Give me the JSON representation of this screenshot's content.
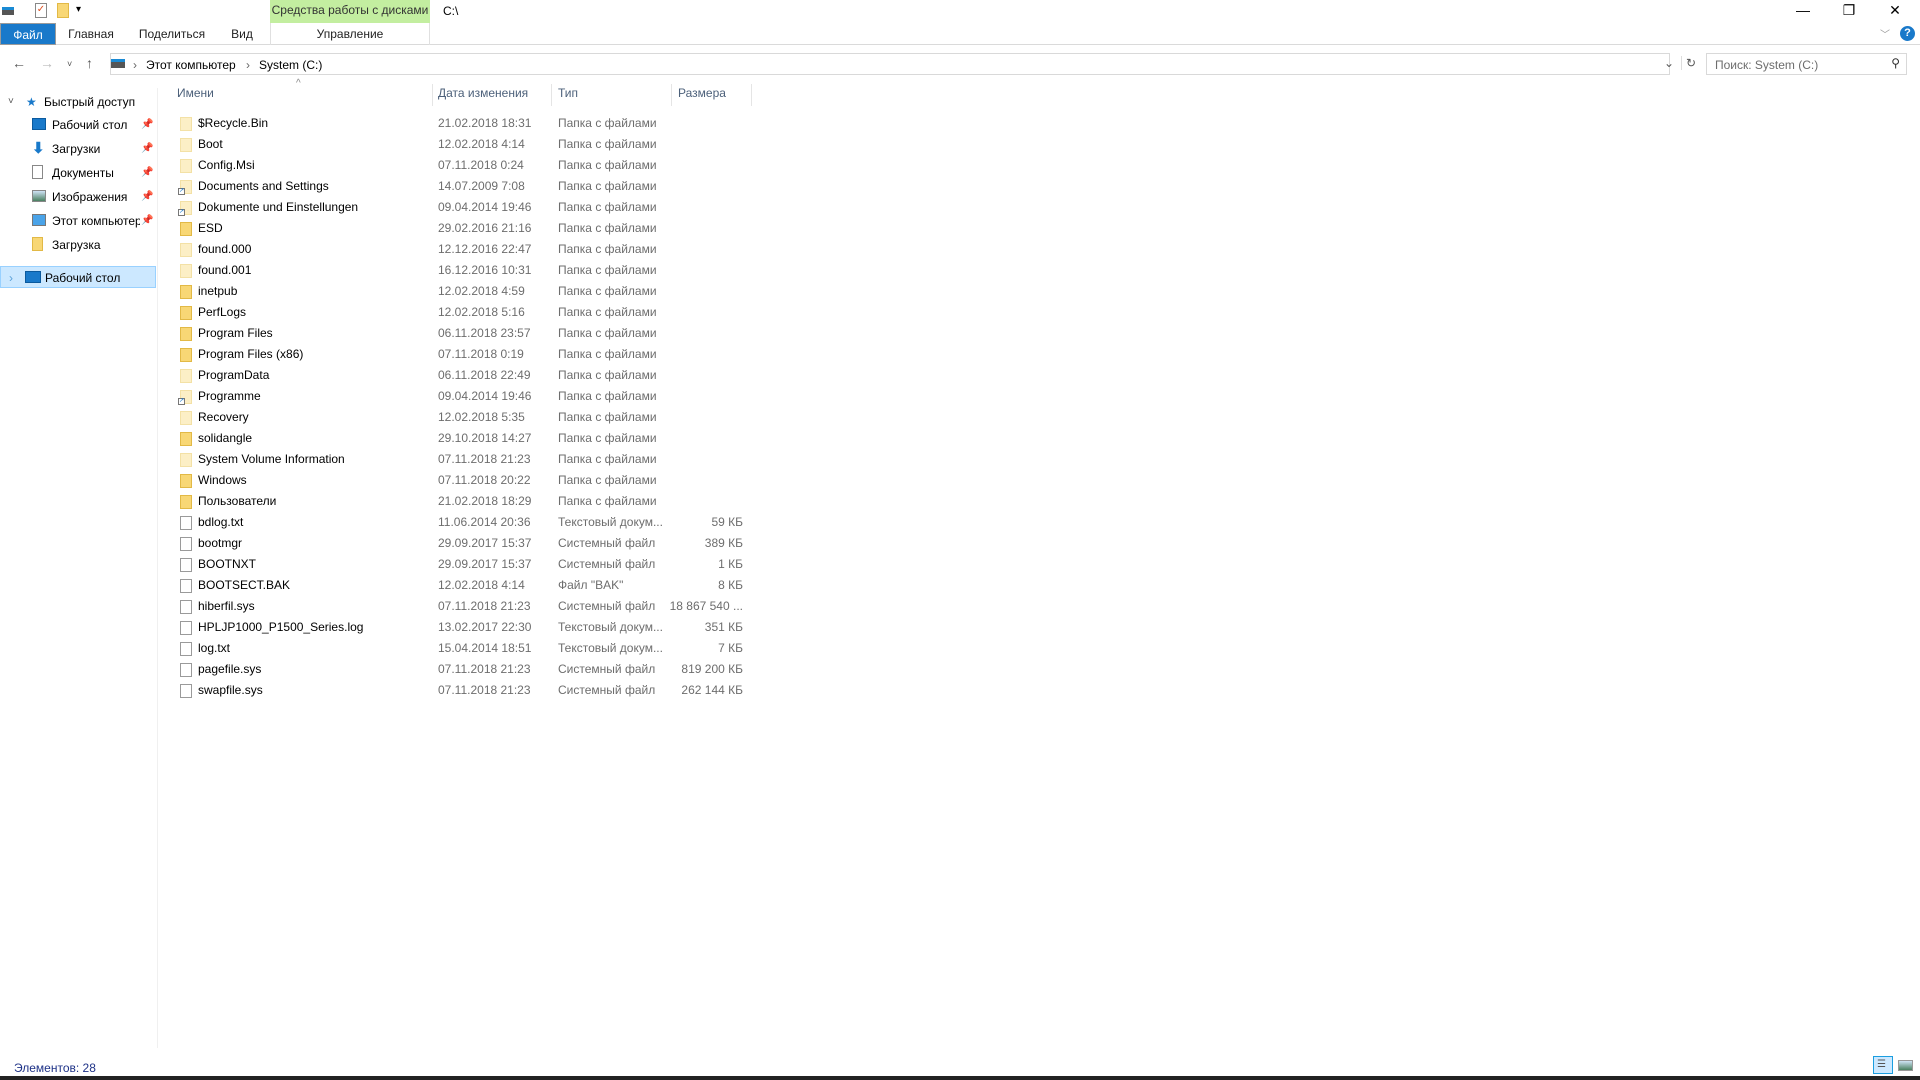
{
  "titlebar": {
    "title": "C:\\",
    "context_group": "Средства работы с дисками",
    "minimize": "—",
    "restore": "❐",
    "close": "✕"
  },
  "ribbon": {
    "tabs": [
      "Файл",
      "Главная",
      "Поделиться",
      "Вид"
    ],
    "context_tab": "Управление",
    "help": "?"
  },
  "address": {
    "path": [
      "Этот компьютер",
      "System (C:)"
    ],
    "search_placeholder": "Поиск: System (C:)"
  },
  "nav": {
    "quick_access": "Быстрый доступ",
    "items": [
      {
        "label": "Рабочий стол",
        "pinned": true,
        "icon": "desktop-icon"
      },
      {
        "label": "Загрузки",
        "pinned": true,
        "icon": "download-icon"
      },
      {
        "label": "Документы",
        "pinned": true,
        "icon": "documents-icon"
      },
      {
        "label": "Изображения",
        "pinned": true,
        "icon": "pictures-icon"
      },
      {
        "label": "Этот компьютер",
        "pinned": true,
        "icon": "computer-icon"
      },
      {
        "label": "Загрузка",
        "pinned": false,
        "icon": "folder-icon"
      }
    ],
    "desktop": "Рабочий стол"
  },
  "columns": {
    "name": "Имени",
    "date": "Дата изменения",
    "type": "Тип",
    "size": "Размера"
  },
  "files": [
    {
      "name": "$Recycle.Bin",
      "date": "21.02.2018 18:31",
      "type": "Папка с файлами",
      "size": "",
      "kind": "hidden-folder"
    },
    {
      "name": "Boot",
      "date": "12.02.2018 4:14",
      "type": "Папка с файлами",
      "size": "",
      "kind": "hidden-folder"
    },
    {
      "name": "Config.Msi",
      "date": "07.11.2018 0:24",
      "type": "Папка с файлами",
      "size": "",
      "kind": "hidden-folder"
    },
    {
      "name": "Documents and Settings",
      "date": "14.07.2009 7:08",
      "type": "Папка с файлами",
      "size": "",
      "kind": "link-folder"
    },
    {
      "name": "Dokumente und Einstellungen",
      "date": "09.04.2014 19:46",
      "type": "Папка с файлами",
      "size": "",
      "kind": "link-folder"
    },
    {
      "name": "ESD",
      "date": "29.02.2016 21:16",
      "type": "Папка с файлами",
      "size": "",
      "kind": "folder"
    },
    {
      "name": "found.000",
      "date": "12.12.2016 22:47",
      "type": "Папка с файлами",
      "size": "",
      "kind": "hidden-folder"
    },
    {
      "name": "found.001",
      "date": "16.12.2016 10:31",
      "type": "Папка с файлами",
      "size": "",
      "kind": "hidden-folder"
    },
    {
      "name": "inetpub",
      "date": "12.02.2018 4:59",
      "type": "Папка с файлами",
      "size": "",
      "kind": "folder"
    },
    {
      "name": "PerfLogs",
      "date": "12.02.2018 5:16",
      "type": "Папка с файлами",
      "size": "",
      "kind": "folder"
    },
    {
      "name": "Program Files",
      "date": "06.11.2018 23:57",
      "type": "Папка с файлами",
      "size": "",
      "kind": "folder"
    },
    {
      "name": "Program Files (x86)",
      "date": "07.11.2018 0:19",
      "type": "Папка с файлами",
      "size": "",
      "kind": "folder"
    },
    {
      "name": "ProgramData",
      "date": "06.11.2018 22:49",
      "type": "Папка с файлами",
      "size": "",
      "kind": "hidden-folder"
    },
    {
      "name": "Programme",
      "date": "09.04.2014 19:46",
      "type": "Папка с файлами",
      "size": "",
      "kind": "link-folder"
    },
    {
      "name": "Recovery",
      "date": "12.02.2018 5:35",
      "type": "Папка с файлами",
      "size": "",
      "kind": "hidden-folder"
    },
    {
      "name": "solidangle",
      "date": "29.10.2018 14:27",
      "type": "Папка с файлами",
      "size": "",
      "kind": "folder"
    },
    {
      "name": "System Volume Information",
      "date": "07.11.2018 21:23",
      "type": "Папка с файлами",
      "size": "",
      "kind": "hidden-folder"
    },
    {
      "name": "Windows",
      "date": "07.11.2018 20:22",
      "type": "Папка с файлами",
      "size": "",
      "kind": "folder"
    },
    {
      "name": "Пользователи",
      "date": "21.02.2018 18:29",
      "type": "Папка с файлами",
      "size": "",
      "kind": "folder"
    },
    {
      "name": "bdlog.txt",
      "date": "11.06.2014 20:36",
      "type": "Текстовый докум...",
      "size": "59 КБ",
      "kind": "file"
    },
    {
      "name": "bootmgr",
      "date": "29.09.2017 15:37",
      "type": "Системный файл",
      "size": "389 КБ",
      "kind": "file"
    },
    {
      "name": "BOOTNXT",
      "date": "29.09.2017 15:37",
      "type": "Системный файл",
      "size": "1 КБ",
      "kind": "file"
    },
    {
      "name": "BOOTSECT.BAK",
      "date": "12.02.2018 4:14",
      "type": "Файл \"BAK\"",
      "size": "8 КБ",
      "kind": "file"
    },
    {
      "name": "hiberfil.sys",
      "date": "07.11.2018 21:23",
      "type": "Системный файл",
      "size": "18 867 540 ...",
      "kind": "file"
    },
    {
      "name": "HPLJP1000_P1500_Series.log",
      "date": "13.02.2017 22:30",
      "type": "Текстовый докум...",
      "size": "351 КБ",
      "kind": "file"
    },
    {
      "name": "log.txt",
      "date": "15.04.2014 18:51",
      "type": "Текстовый докум...",
      "size": "7 КБ",
      "kind": "file"
    },
    {
      "name": "pagefile.sys",
      "date": "07.11.2018 21:23",
      "type": "Системный файл",
      "size": "819 200 КБ",
      "kind": "file"
    },
    {
      "name": "swapfile.sys",
      "date": "07.11.2018 21:23",
      "type": "Системный файл",
      "size": "262 144 КБ",
      "kind": "file"
    }
  ],
  "status": {
    "count": "Элементов: 28"
  }
}
